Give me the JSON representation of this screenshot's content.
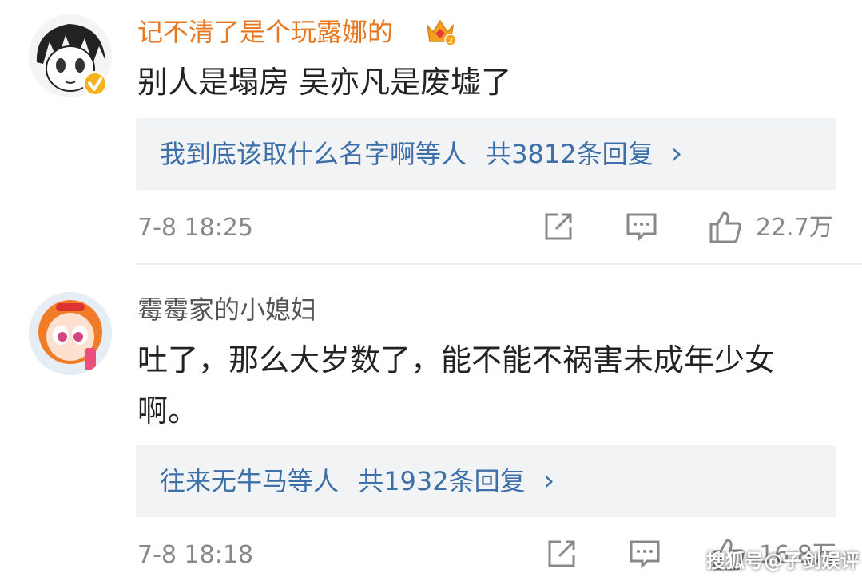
{
  "comments": [
    {
      "username": "记不清了是个玩露娜的",
      "text": "别人是塌房 吴亦凡是废墟了",
      "reply_from": "我到底该取什么名字啊等人",
      "reply_count": "共3812条回复",
      "reply_chevron": "›",
      "time": "7-8 18:25",
      "likes": "22.7万",
      "username_color": "#e8771f",
      "verified": true
    },
    {
      "username": "霉霉家的小媳妇",
      "text_line1": "吐了，那么大岁数了，能不能不祸害未成年少女",
      "text_line2": "啊。",
      "reply_from": "往来无牛马等人",
      "reply_count": "共1932条回复",
      "reply_chevron": "›",
      "time": "7-8 18:18",
      "likes": "16.8万",
      "username_color": "#555555"
    }
  ],
  "watermark": "搜狐号@子剑娱评",
  "icons": [
    "crown-vip-icon",
    "verified-badge-icon",
    "share-icon",
    "comment-icon",
    "like-icon",
    "chevron-right-icon"
  ]
}
